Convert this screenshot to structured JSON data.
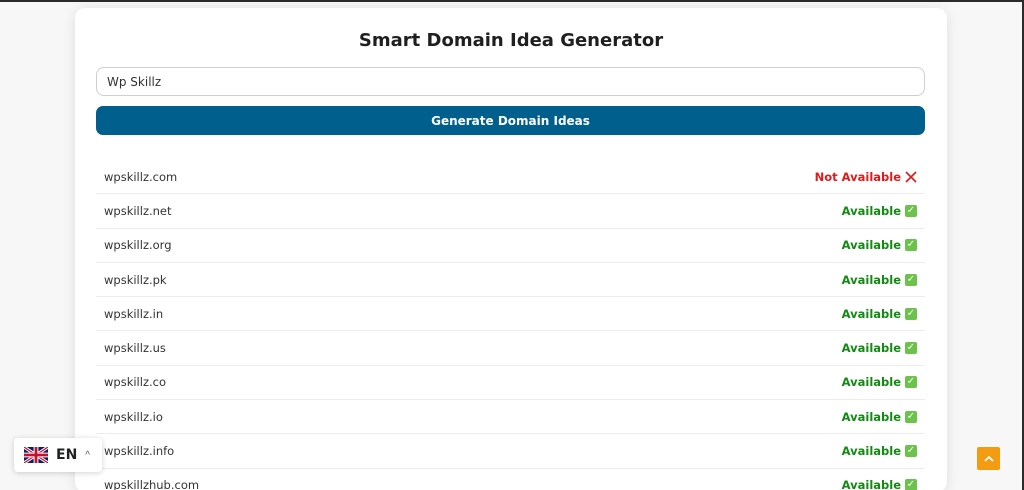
{
  "app": {
    "title": "Smart Domain Idea Generator",
    "search": {
      "value": "Wp Skillz",
      "placeholder": ""
    },
    "generate_label": "Generate Domain Ideas"
  },
  "results": [
    {
      "domain": "wpskillz.com",
      "status": "Not Available",
      "available": false
    },
    {
      "domain": "wpskillz.net",
      "status": "Available",
      "available": true
    },
    {
      "domain": "wpskillz.org",
      "status": "Available",
      "available": true
    },
    {
      "domain": "wpskillz.pk",
      "status": "Available",
      "available": true
    },
    {
      "domain": "wpskillz.in",
      "status": "Available",
      "available": true
    },
    {
      "domain": "wpskillz.us",
      "status": "Available",
      "available": true
    },
    {
      "domain": "wpskillz.co",
      "status": "Available",
      "available": true
    },
    {
      "domain": "wpskillz.io",
      "status": "Available",
      "available": true
    },
    {
      "domain": "wpskillz.info",
      "status": "Available",
      "available": true
    },
    {
      "domain": "wpskillzhub.com",
      "status": "Available",
      "available": true
    }
  ],
  "language": {
    "code": "EN",
    "flag_icon": "uk-flag-icon"
  },
  "icons": {
    "available": "check-icon",
    "not_available": "x-icon",
    "scroll_top": "chevron-up-icon"
  },
  "colors": {
    "accent": "#005f8c",
    "available": "#138a13",
    "not_available": "#e01b1b",
    "scroll_button": "#f39c12"
  }
}
